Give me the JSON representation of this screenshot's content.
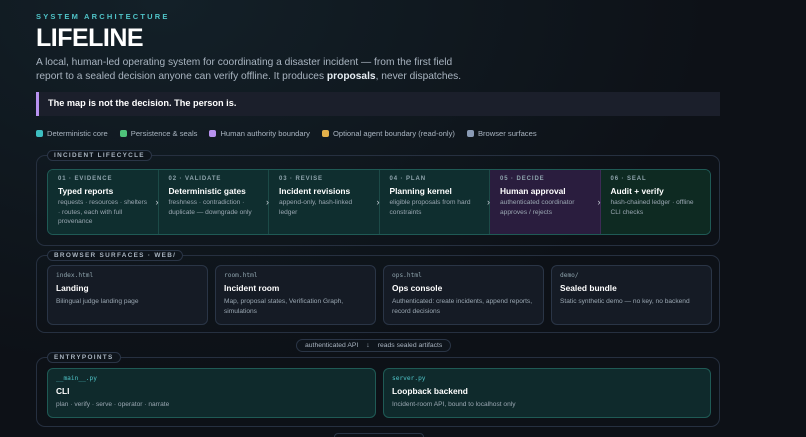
{
  "header": {
    "eyebrow": "SYSTEM ARCHITECTURE",
    "title": "LIFELINE",
    "subtitle_before": "A local, human-led operating system for coordinating a disaster incident — from the first field report to a sealed decision anyone can verify offline. It produces ",
    "subtitle_bold": "proposals",
    "subtitle_after": ", never dispatches."
  },
  "callout": "The map is not the decision. The person is.",
  "legend": [
    {
      "label": "Deterministic core",
      "color": "#3dbfc1"
    },
    {
      "label": "Persistence & seals",
      "color": "#4fc27a"
    },
    {
      "label": "Human authority boundary",
      "color": "#b892f0"
    },
    {
      "label": "Optional agent boundary (read-only)",
      "color": "#e2b04a"
    },
    {
      "label": "Browser surfaces",
      "color": "#8a9bb5"
    }
  ],
  "lifecycle": {
    "label": "INCIDENT LIFECYCLE",
    "stages": [
      {
        "num": "01 · EVIDENCE",
        "title": "Typed reports",
        "desc": "requests · resources · shelters · routes, each with full provenance"
      },
      {
        "num": "02 · VALIDATE",
        "title": "Deterministic gates",
        "desc": "freshness · contradiction · duplicate — downgrade only"
      },
      {
        "num": "03 · REVISE",
        "title": "Incident revisions",
        "desc": "append-only, hash-linked ledger"
      },
      {
        "num": "04 · PLAN",
        "title": "Planning kernel",
        "desc": "eligible proposals from hard constraints"
      },
      {
        "num": "05 · DECIDE",
        "title": "Human approval",
        "desc": "authenticated coordinator approves / rejects"
      },
      {
        "num": "06 · SEAL",
        "title": "Audit + verify",
        "desc": "hash-chained ledger · offline CLI checks"
      }
    ]
  },
  "browser": {
    "label": "BROWSER SURFACES · WEB/",
    "cards": [
      {
        "code": "index.html",
        "title": "Landing",
        "desc": "Bilingual judge landing page"
      },
      {
        "code": "room.html",
        "title": "Incident room",
        "desc": "Map, proposal states, Verification Graph, simulations"
      },
      {
        "code": "ops.html",
        "title": "Ops console",
        "desc": "Authenticated: create incidents, append reports, record decisions"
      },
      {
        "code": "demo/",
        "title": "Sealed bundle",
        "desc": "Static synthetic demo — no key, no backend"
      }
    ]
  },
  "connector": {
    "left": "authenticated API",
    "arrow": "↓",
    "right": "reads sealed artifacts"
  },
  "entrypoints": {
    "label": "ENTRYPOINTS",
    "cards": [
      {
        "code": "__main__.py",
        "title": "CLI",
        "desc": "plan · verify · serve · operator · narrate"
      },
      {
        "code": "server.py",
        "title": "Loopback backend",
        "desc": "Incident-room API, bound to localhost only"
      }
    ]
  }
}
